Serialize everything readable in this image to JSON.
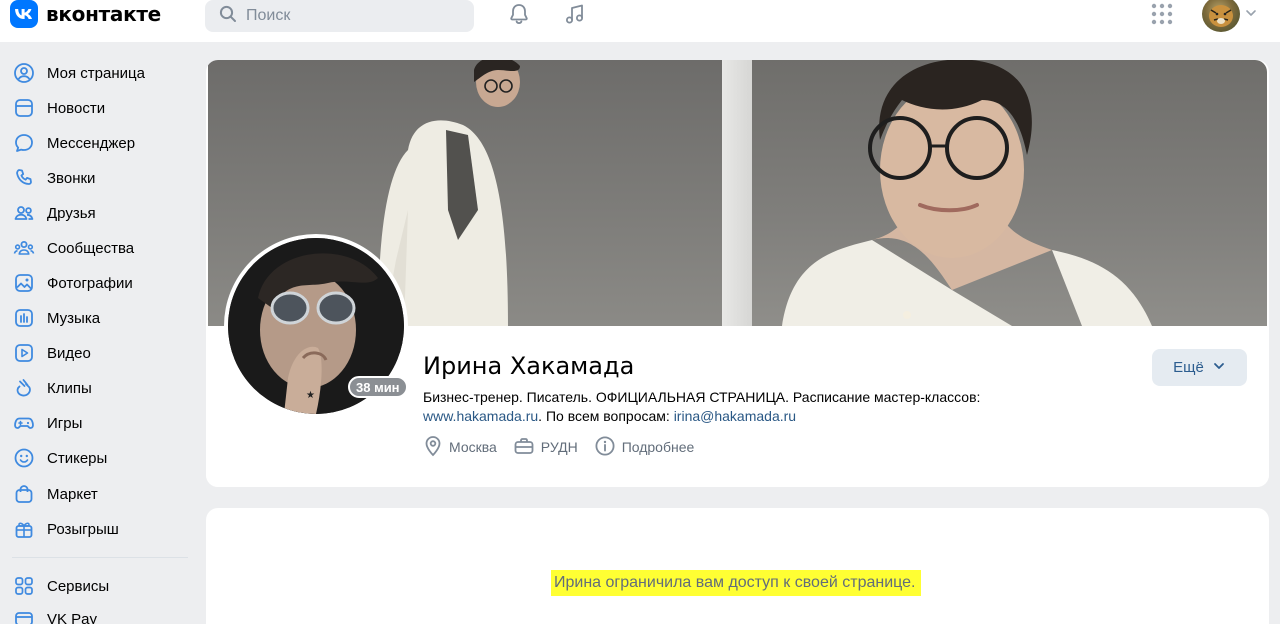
{
  "header": {
    "logo_text": "вконтакте",
    "search_placeholder": "Поиск",
    "icons": [
      "notifications-bell-icon",
      "music-note-icon",
      "apps-grid-icon",
      "chevron-down-icon"
    ]
  },
  "sidebar": {
    "items": [
      {
        "label": "Моя страница",
        "icon": "profile-icon"
      },
      {
        "label": "Новости",
        "icon": "news-icon"
      },
      {
        "label": "Мессенджер",
        "icon": "messenger-icon"
      },
      {
        "label": "Звонки",
        "icon": "phone-icon"
      },
      {
        "label": "Друзья",
        "icon": "friends-icon"
      },
      {
        "label": "Сообщества",
        "icon": "communities-icon"
      },
      {
        "label": "Фотографии",
        "icon": "photos-icon"
      },
      {
        "label": "Музыка",
        "icon": "music-icon"
      },
      {
        "label": "Видео",
        "icon": "video-icon"
      },
      {
        "label": "Клипы",
        "icon": "clips-icon"
      },
      {
        "label": "Игры",
        "icon": "games-icon"
      },
      {
        "label": "Стикеры",
        "icon": "stickers-icon"
      },
      {
        "label": "Маркет",
        "icon": "market-icon"
      },
      {
        "label": "Розыгрыш",
        "icon": "giveaway-icon"
      }
    ],
    "extra_items": [
      {
        "label": "Сервисы",
        "icon": "services-icon"
      },
      {
        "label": "VK Pay",
        "icon": "vkpay-icon"
      }
    ]
  },
  "profile": {
    "name": "Ирина Хакамада",
    "bio_text": "Бизнес-тренер. Писатель. ОФИЦИАЛЬНАЯ СТРАНИЦА. Расписание мастер-классов:",
    "bio_link_site": "www.hakamada.ru",
    "bio_mid": ". По всем вопросам: ",
    "bio_link_email": "irina@hakamada.ru",
    "last_seen_badge": "38 мин",
    "city": "Москва",
    "university": "РУДН",
    "details_label": "Подробнее",
    "more_button": "Ещё"
  },
  "restricted_message": "Ирина ограничила вам доступ к своей странице.",
  "colors": {
    "accent": "#0077ff",
    "link": "#2a5885",
    "icon": "#0077ff",
    "highlight": "#ffff33",
    "background": "#edeef0"
  }
}
